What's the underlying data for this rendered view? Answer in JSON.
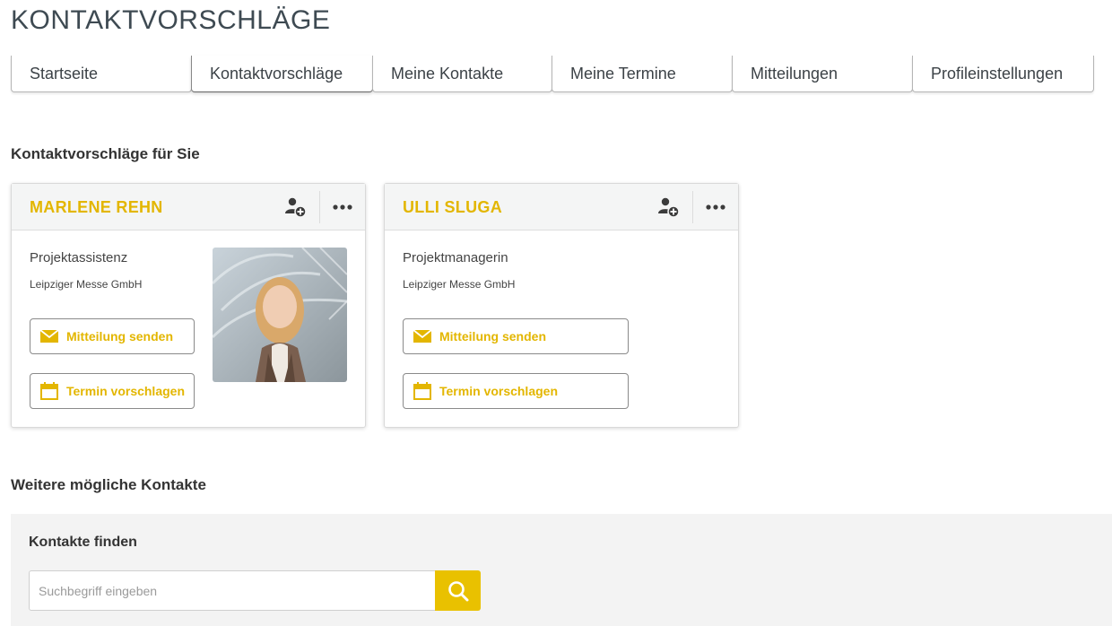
{
  "page": {
    "title": "KONTAKTVORSCHLÄGE"
  },
  "tabs": [
    {
      "label": "Startseite"
    },
    {
      "label": "Kontaktvorschläge"
    },
    {
      "label": "Meine Kontakte"
    },
    {
      "label": "Meine Termine"
    },
    {
      "label": "Mitteilungen"
    },
    {
      "label": "Profileinstellungen"
    }
  ],
  "active_tab": "Kontaktvorschläge",
  "suggestions": {
    "heading": "Kontaktvorschläge für Sie",
    "cards": [
      {
        "name": "MARLENE REHN",
        "role": "Projektassistenz",
        "company": "Leipziger Messe GmbH",
        "message_label": "Mitteilung senden",
        "appointment_label": "Termin vorschlagen",
        "has_photo": true
      },
      {
        "name": "ULLI SLUGA",
        "role": "Projektmanagerin",
        "company": "Leipziger Messe GmbH",
        "message_label": "Mitteilung senden",
        "appointment_label": "Termin vorschlagen",
        "has_photo": false
      }
    ]
  },
  "more_contacts": {
    "heading": "Weitere mögliche Kontakte",
    "search": {
      "label": "Kontakte finden",
      "placeholder": "Suchbegriff eingeben",
      "value": ""
    }
  },
  "icons": {
    "add_contact": "add-contact-icon",
    "more": "more-options-icon",
    "message": "envelope-icon",
    "appointment": "calendar-icon",
    "search": "search-icon"
  },
  "colors": {
    "accent": "#e3b600",
    "search_button": "#e9c100",
    "header_bg": "#f4f5f5",
    "panel_bg": "#f3f3f3"
  }
}
